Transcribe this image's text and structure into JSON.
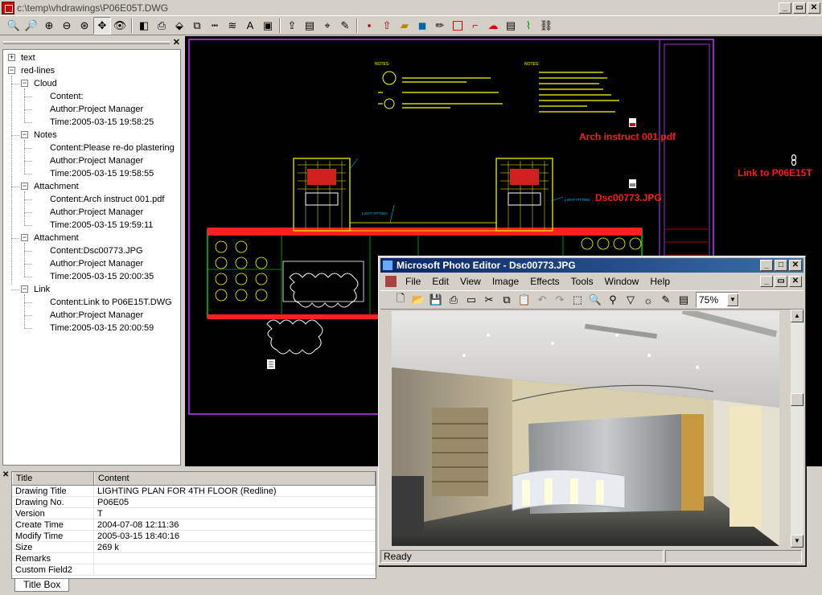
{
  "app": {
    "title": "c:\\temp\\vhdrawings\\P06E05T.DWG",
    "window_controls": [
      "_",
      "▭",
      "✕"
    ]
  },
  "toolbar": {
    "icons": [
      "zoom-in-icon",
      "zoom-out-icon",
      "zoom-window-icon",
      "zoom-previous-icon",
      "zoom-extents-icon",
      "pan-icon",
      "view-icon",
      "color-icon",
      "print-icon",
      "3d-icon",
      "layers-icon",
      "line-style-icon",
      "layer-stack-icon",
      "text-icon",
      "view-mode-icon",
      "export-icon",
      "properties-icon",
      "measure-icon",
      "edit-icon",
      "save-icon",
      "upload-icon",
      "open-icon",
      "compress-icon",
      "pen-icon",
      "rectangle-icon",
      "polygon-icon",
      "cloud-icon",
      "note-icon",
      "attachment-icon",
      "link-icon"
    ]
  },
  "tree": {
    "root_text": "text",
    "root_redlines": "red-lines",
    "groups": [
      {
        "label": "Cloud",
        "content": "Content:",
        "author": "Author:Project Manager",
        "time": "Time:2005-03-15 19:58:25"
      },
      {
        "label": "Notes",
        "content": "Content:Please re-do plastering",
        "author": "Author:Project Manager",
        "time": "Time:2005-03-15 19:58:55"
      },
      {
        "label": "Attachment",
        "content": "Content:Arch instruct 001.pdf",
        "author": "Author:Project Manager",
        "time": "Time:2005-03-15 19:59:11"
      },
      {
        "label": "Attachment",
        "content": "Content:Dsc00773.JPG",
        "author": "Author:Project Manager",
        "time": "Time:2005-03-15 20:00:35"
      },
      {
        "label": "Link",
        "content": "Content:Link to P06E15T.DWG",
        "author": "Author:Project Manager",
        "time": "Time:2005-03-15 20:00:59"
      }
    ]
  },
  "canvas": {
    "anno_pdf": "Arch instruct 001.pdf",
    "anno_jpg": "Dsc00773.JPG",
    "anno_link": "Link to P06E15T",
    "notes_label_1": "NOTES:",
    "notes_label_2": "NOTES:"
  },
  "properties": {
    "col_title": "Title",
    "col_content": "Content",
    "rows": [
      {
        "title": "Drawing Title",
        "content": "LIGHTING PLAN FOR 4TH FLOOR (Redline)"
      },
      {
        "title": "Drawing No.",
        "content": "P06E05"
      },
      {
        "title": "Version",
        "content": "T"
      },
      {
        "title": "Create Time",
        "content": "2004-07-08 12:11:36"
      },
      {
        "title": "Modify Time",
        "content": "2005-03-15 18:40:16"
      },
      {
        "title": "Size",
        "content": "269 k"
      },
      {
        "title": "Remarks",
        "content": ""
      },
      {
        "title": "Custom Field2",
        "content": ""
      }
    ],
    "tab": "Title Box"
  },
  "photo_editor": {
    "title": "Microsoft Photo Editor - Dsc00773.JPG",
    "menu": [
      "File",
      "Edit",
      "View",
      "Image",
      "Effects",
      "Tools",
      "Window",
      "Help"
    ],
    "zoom": "75%",
    "status": "Ready"
  },
  "colors": {
    "cad_yellow": "#ffff00",
    "cad_red": "#ff1a1a",
    "cad_green": "#00ff00",
    "cad_magenta": "#c040ff",
    "pe_titlebar": "#0a246a"
  }
}
